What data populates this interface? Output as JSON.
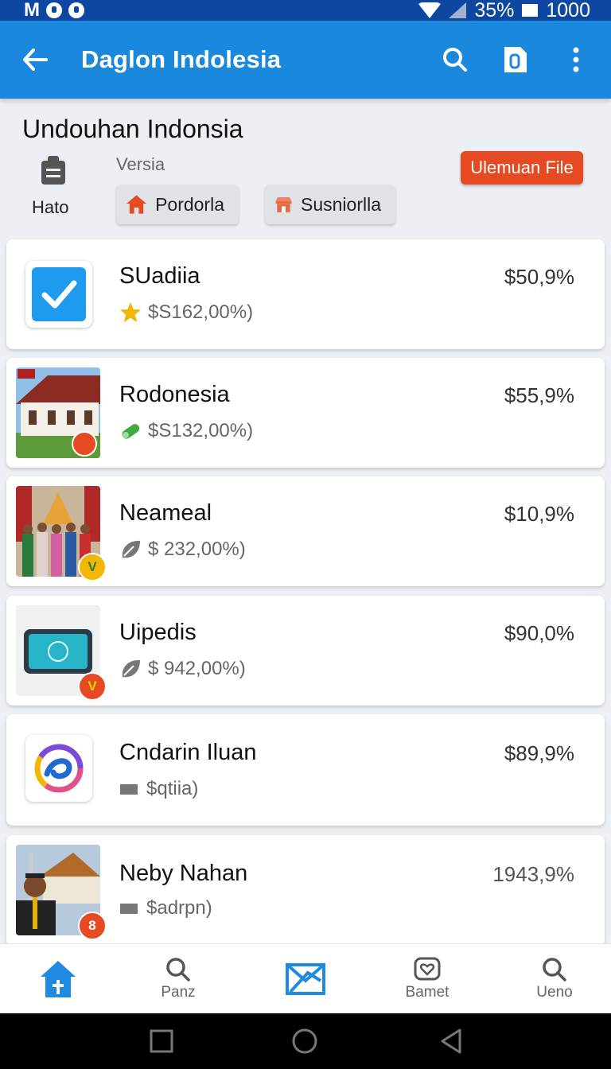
{
  "status_bar": {
    "left_letter": "M",
    "battery": "35%",
    "time": "1000"
  },
  "app_bar": {
    "title": "Daglon Indolesia",
    "icons": [
      "back-arrow-icon",
      "search-icon",
      "document-icon",
      "more-vert-icon"
    ]
  },
  "section": {
    "title": "Undouhan Indonsia",
    "hato_label": "Hato",
    "versia_label": "Versia",
    "chips": [
      "Pordorla",
      "Susniorlla"
    ],
    "upload_button": "Ulemuan File"
  },
  "items": [
    {
      "name": "SUadiia",
      "sub": "$S162,00%)",
      "price": "$50,9%",
      "sub_icon": "star-icon",
      "thumb": "checkbox-icon"
    },
    {
      "name": "Rodonesia",
      "sub": "$S132,00%)",
      "price": "$55,9%",
      "sub_icon": "pill-icon",
      "thumb": "house-photo"
    },
    {
      "name": "Neameal",
      "sub": "$ 232,00%)",
      "price": "$10,9%",
      "sub_icon": "leaf-icon",
      "thumb": "people-photo"
    },
    {
      "name": "Uipedis",
      "sub": "$ 942,00%)",
      "price": "$90,0%",
      "sub_icon": "leaf-icon",
      "thumb": "tablet-photo"
    },
    {
      "name": "Cndarin Iluan",
      "sub": "$qtiia)",
      "price": "$89,9%",
      "sub_icon": "folder-icon",
      "thumb": "swirl-logo-icon"
    },
    {
      "name": "Neby Nahan",
      "sub": "$adrpn)",
      "price": "1943,9%",
      "sub_icon": "folder-icon",
      "thumb": "man-photo"
    }
  ],
  "thumb_badges": [
    "V",
    "V",
    "8"
  ],
  "bottom_nav": [
    {
      "label": "",
      "icon": "home-icon"
    },
    {
      "label": "Panz",
      "icon": "search-icon"
    },
    {
      "label": "",
      "icon": "mail-icon"
    },
    {
      "label": "Bamet",
      "icon": "heart-badge-icon"
    },
    {
      "label": "Ueno",
      "icon": "search-icon"
    }
  ],
  "colors": {
    "primary": "#1a88dc",
    "status_bar": "#0d47a1",
    "accent": "#e64a22"
  }
}
